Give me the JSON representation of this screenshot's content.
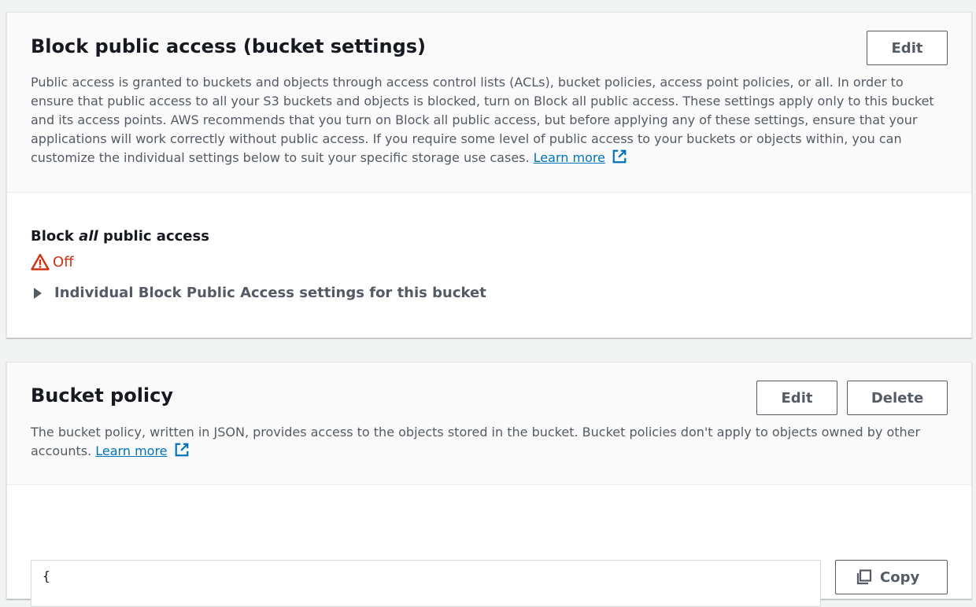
{
  "block_public_access": {
    "title": "Block public access (bucket settings)",
    "edit_label": "Edit",
    "description": "Public access is granted to buckets and objects through access control lists (ACLs), bucket policies, access point policies, or all. In order to ensure that public access to all your S3 buckets and objects is blocked, turn on Block all public access. These settings apply only to this bucket and its access points. AWS recommends that you turn on Block all public access, but before applying any of these settings, ensure that your applications will work correctly without public access. If you require some level of public access to your buckets or objects within, you can customize the individual settings below to suit your specific storage use cases.",
    "learn_more": "Learn more",
    "field_label_prefix": "Block ",
    "field_label_emphasis": "all",
    "field_label_suffix": " public access",
    "status": "Off",
    "expander_label": "Individual Block Public Access settings for this bucket"
  },
  "bucket_policy": {
    "title": "Bucket policy",
    "edit_label": "Edit",
    "delete_label": "Delete",
    "description": "The bucket policy, written in JSON, provides access to the objects stored in the bucket. Bucket policies don't apply to objects owned by other accounts.",
    "learn_more": "Learn more",
    "code_first_line": "{",
    "copy_label": "Copy"
  },
  "colors": {
    "link": "#0073bb",
    "warning": "#d13212",
    "text_secondary": "#545b64"
  }
}
